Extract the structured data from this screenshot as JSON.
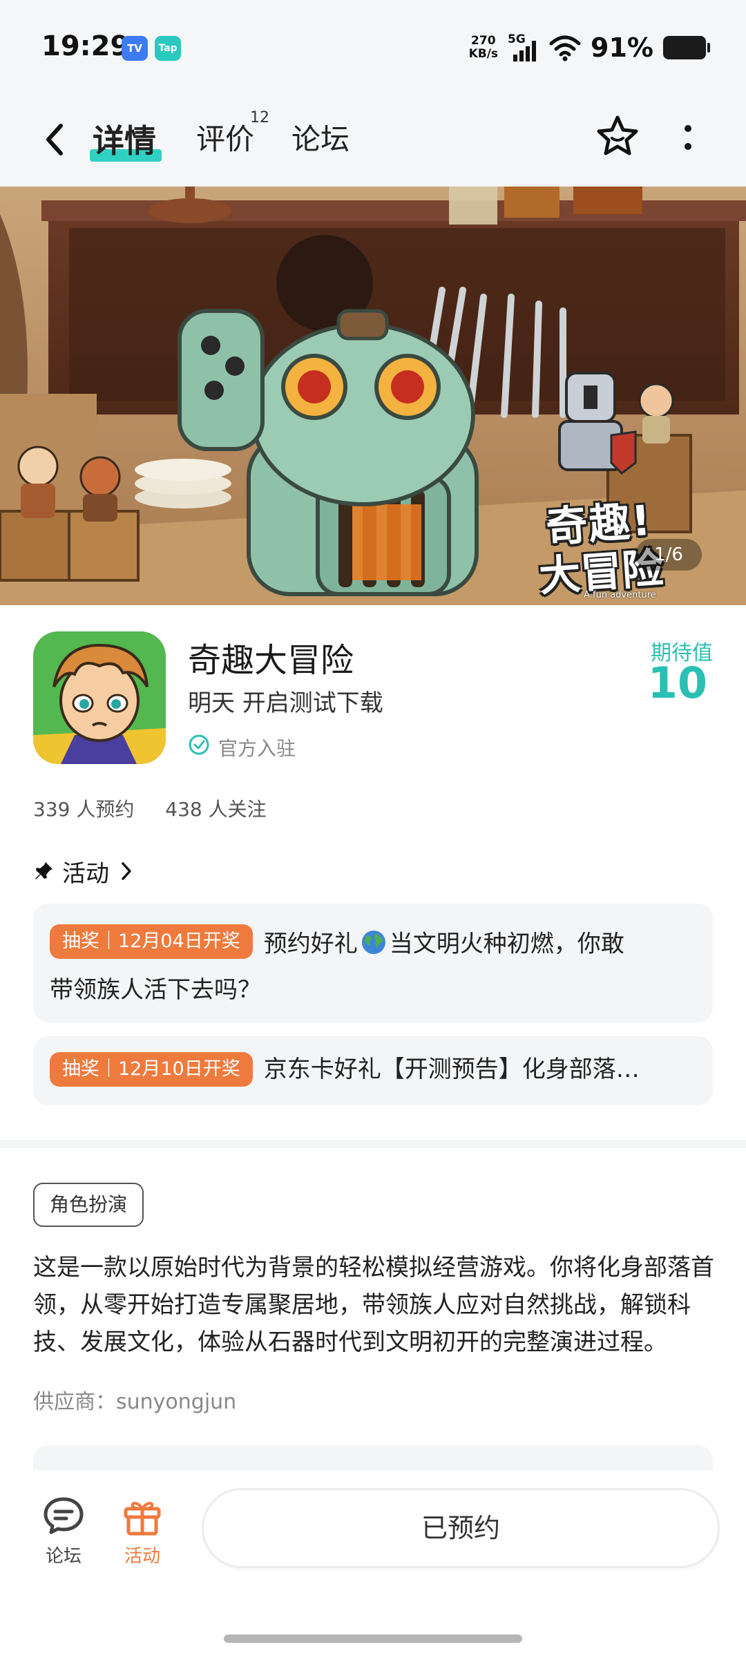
{
  "status_bar": {
    "time": "19:29",
    "app_icon_1": "TV",
    "app_icon_2": "Tap",
    "net_speed_value": "270",
    "net_speed_unit": "KB/s",
    "network": "5G",
    "battery": "91%"
  },
  "nav": {
    "tabs": [
      {
        "label": "详情",
        "active": true
      },
      {
        "label": "评价",
        "count": "12"
      },
      {
        "label": "论坛"
      }
    ],
    "icons": [
      "back-icon",
      "star-icon",
      "more-icon"
    ]
  },
  "banner": {
    "counter": "1/6",
    "logo_line1": "奇趣!",
    "logo_line2": "大冒险",
    "logo_sub": "A fun adventure"
  },
  "game": {
    "title": "奇趣大冒险",
    "status": "明天 开启测试下载",
    "official": "官方入驻",
    "expect_label": "期待值",
    "expect_value": "10",
    "reservations": "339 人预约",
    "followers": "438 人关注"
  },
  "activity": {
    "title": "活动",
    "items": [
      {
        "tag": "抽奖｜12月04日开奖",
        "text_a": "预约好礼",
        "text_b": "当文明火种初燃，你敢",
        "text_c": "带领族人活下去吗？"
      },
      {
        "tag": "抽奖｜12月10日开奖",
        "text": "京东卡好礼【开测预告】化身部落首领"
      }
    ]
  },
  "description": {
    "genre": "角色扮演",
    "text": "这是一款以原始时代为背景的轻松模拟经营游戏。你将化身部落首领，从零开始打造专属聚居地，带领族人应对自然挑战，解锁科技、发展文化，体验从石器时代到文明初开的完整演进过程。",
    "supplier": "供应商：sunyongjun"
  },
  "bottom_bar": {
    "forum_label": "论坛",
    "activity_label": "活动",
    "reserve_label": "已预约"
  },
  "colors": {
    "accent_teal": "#2bbfb3",
    "tab_underline": "#2fd1c3",
    "activity_orange": "#ee7a3e"
  }
}
